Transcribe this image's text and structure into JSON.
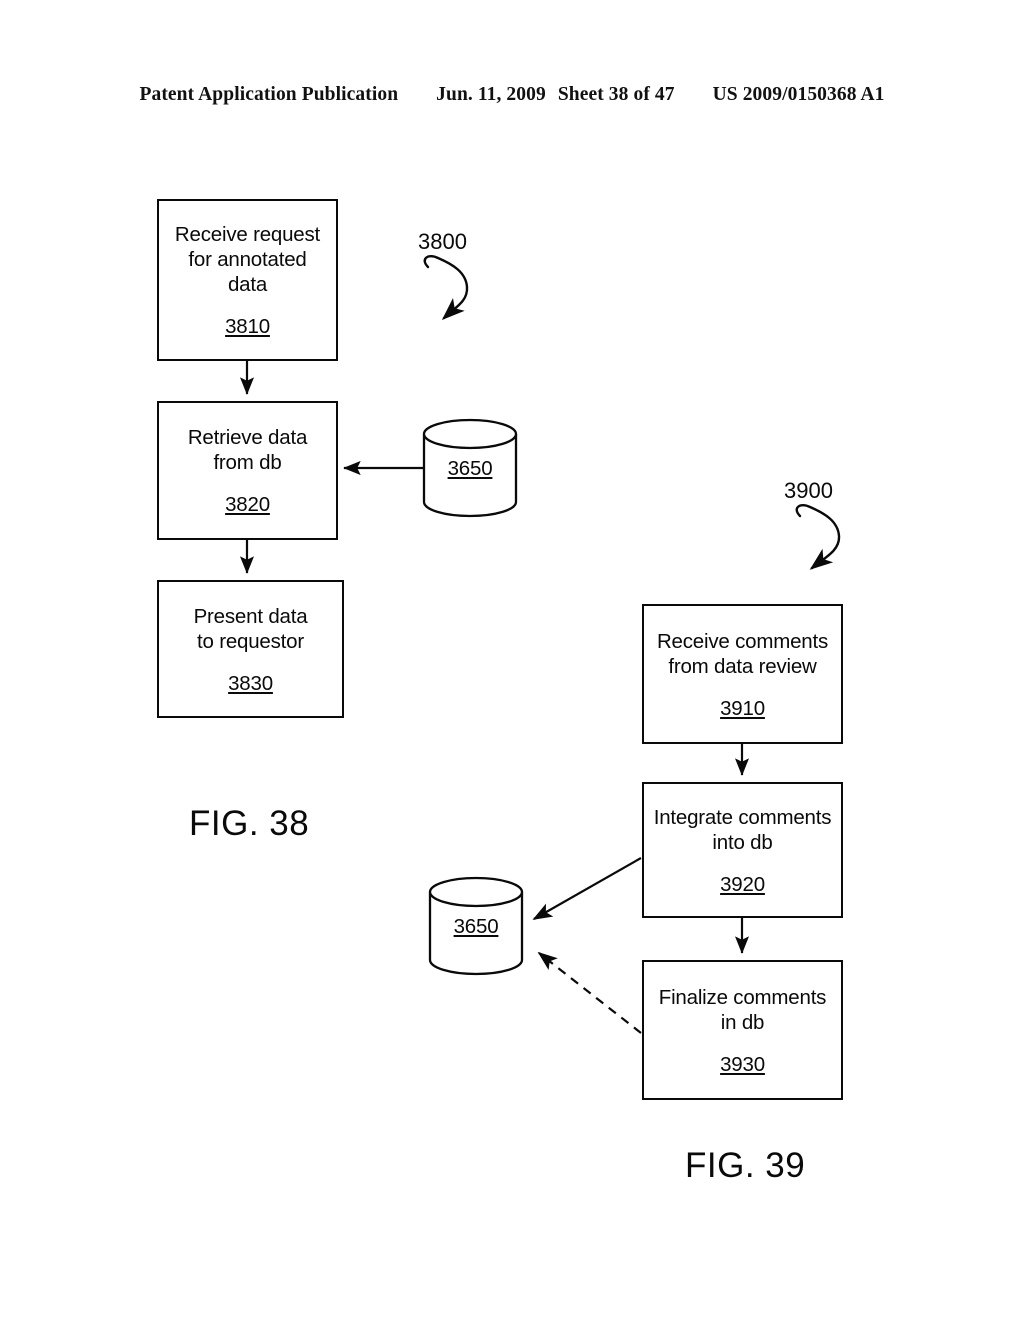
{
  "header": {
    "publication": "Patent Application Publication",
    "date": "Jun. 11, 2009",
    "sheet": "Sheet 38 of 47",
    "document_number": "US 2009/0150368 A1"
  },
  "figures": [
    {
      "caption": "FIG. 38",
      "flow_reference": "3800",
      "steps": [
        {
          "text": "Receive request\nfor annotated\ndata",
          "ref": "3810"
        },
        {
          "text": "Retrieve data\nfrom db",
          "ref": "3820"
        },
        {
          "text": "Present data\nto requestor",
          "ref": "3830"
        }
      ],
      "datastores": [
        {
          "ref": "3650",
          "label": "3650"
        }
      ]
    },
    {
      "caption": "FIG. 39",
      "flow_reference": "3900",
      "steps": [
        {
          "text": "Receive comments\nfrom data review",
          "ref": "3910"
        },
        {
          "text": "Integrate comments\ninto db",
          "ref": "3920"
        },
        {
          "text": "Finalize comments\nin db",
          "ref": "3930"
        }
      ],
      "datastores": [
        {
          "ref": "3650",
          "label": "3650"
        }
      ]
    }
  ],
  "colors": {
    "ink": "#0a0a0a",
    "page": "#ffffff"
  }
}
